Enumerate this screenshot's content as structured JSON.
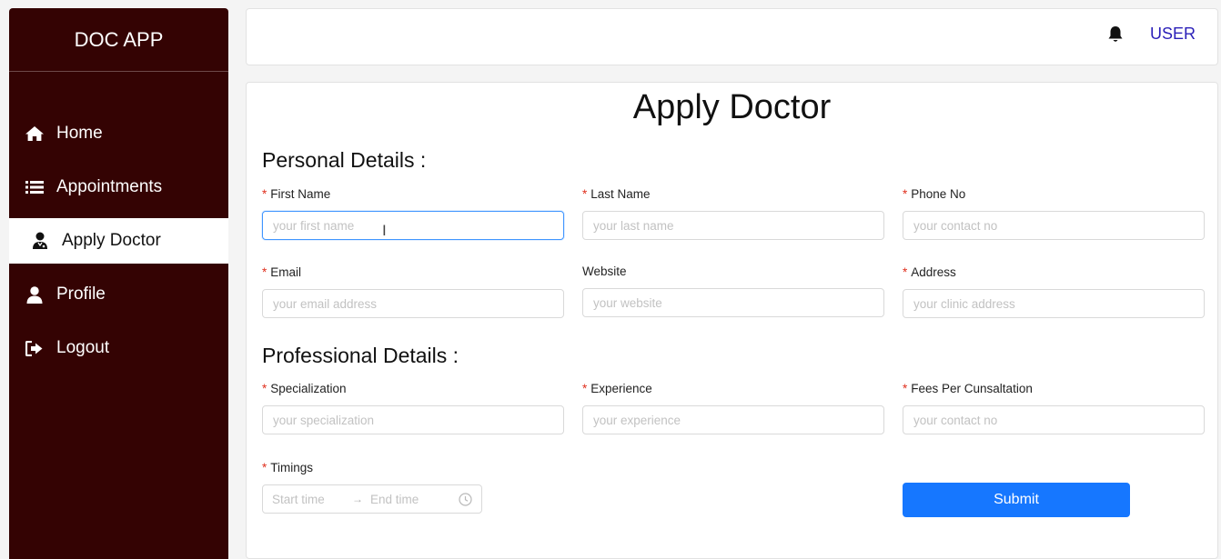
{
  "app": {
    "title": "DOC APP"
  },
  "sidebar": {
    "items": [
      {
        "label": "Home",
        "icon": "home-icon"
      },
      {
        "label": "Appointments",
        "icon": "list-icon"
      },
      {
        "label": "Apply Doctor",
        "icon": "doctor-icon",
        "active": true
      },
      {
        "label": "Profile",
        "icon": "user-icon"
      },
      {
        "label": "Logout",
        "icon": "logout-icon"
      }
    ]
  },
  "header": {
    "user_label": "USER",
    "bell_icon": "bell-icon"
  },
  "form": {
    "title": "Apply Doctor",
    "personal_title": "Personal Details :",
    "professional_title": "Professional Details :",
    "fields": {
      "first_name": {
        "label": "First Name",
        "placeholder": "your first name",
        "required": true
      },
      "last_name": {
        "label": "Last Name",
        "placeholder": "your last name",
        "required": true
      },
      "phone": {
        "label": "Phone No",
        "placeholder": "your contact no",
        "required": true
      },
      "email": {
        "label": "Email",
        "placeholder": "your email address",
        "required": true
      },
      "website": {
        "label": "Website",
        "placeholder": "your website",
        "required": false
      },
      "address": {
        "label": "Address",
        "placeholder": "your clinic address",
        "required": true
      },
      "specialization": {
        "label": "Specialization",
        "placeholder": "your specialization",
        "required": true
      },
      "experience": {
        "label": "Experience",
        "placeholder": "your experience",
        "required": true
      },
      "fees": {
        "label": "Fees Per Cunsaltation",
        "placeholder": "your contact no",
        "required": true
      },
      "timings": {
        "label": "Timings",
        "start_placeholder": "Start time",
        "end_placeholder": "End time",
        "required": true
      }
    },
    "required_mark": "*",
    "submit_label": "Submit"
  },
  "colors": {
    "sidebar_bg": "#340303",
    "primary": "#1677ff",
    "user_link": "#2a1fb8",
    "required": "#e0301e"
  }
}
